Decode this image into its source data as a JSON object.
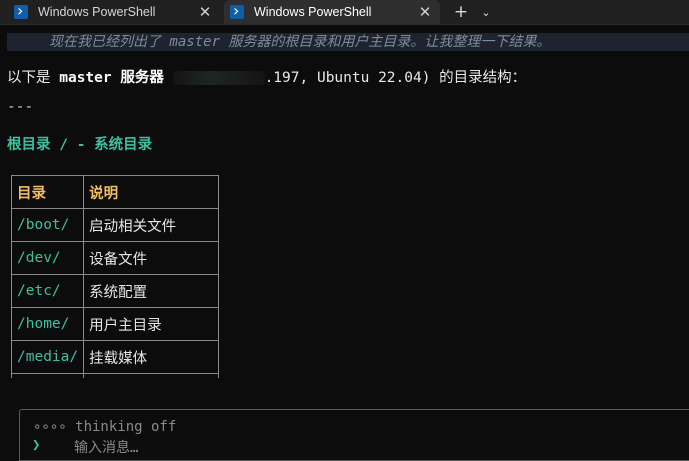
{
  "tabs": [
    {
      "title": "Windows PowerShell",
      "close": "✕",
      "active": false
    },
    {
      "title": "Windows PowerShell",
      "close": "✕",
      "active": true
    }
  ],
  "tabbar": {
    "new_tab": "+",
    "dropdown": "⌄"
  },
  "terminal": {
    "thinking_text": "现在我已经列出了 master 服务器的根目录和用户主目录。让我整理一下结果。",
    "intro_prefix": "以下是 ",
    "intro_server": "master 服务器",
    "intro_ip_tail": ".197",
    "intro_suffix": ", Ubuntu 22.04) 的目录结构：",
    "separator": "---",
    "section_title": "根目录 / - 系统目录",
    "table": {
      "headers": [
        "目录",
        "说明"
      ],
      "rows": [
        [
          "/boot/",
          "启动相关文件"
        ],
        [
          "/dev/",
          "设备文件"
        ],
        [
          "/etc/",
          "系统配置"
        ],
        [
          "/home/",
          "用户主目录"
        ],
        [
          "/media/",
          "挂载媒体"
        ]
      ]
    }
  },
  "input": {
    "status": "∘∘∘∘ thinking off",
    "prompt": "❯",
    "placeholder": "输入消息…"
  },
  "colors": {
    "background": "#0c0c0c",
    "accent_teal": "#3cc0a0",
    "header_gold": "#f0c060",
    "thinking_bg": "#1d2430"
  }
}
